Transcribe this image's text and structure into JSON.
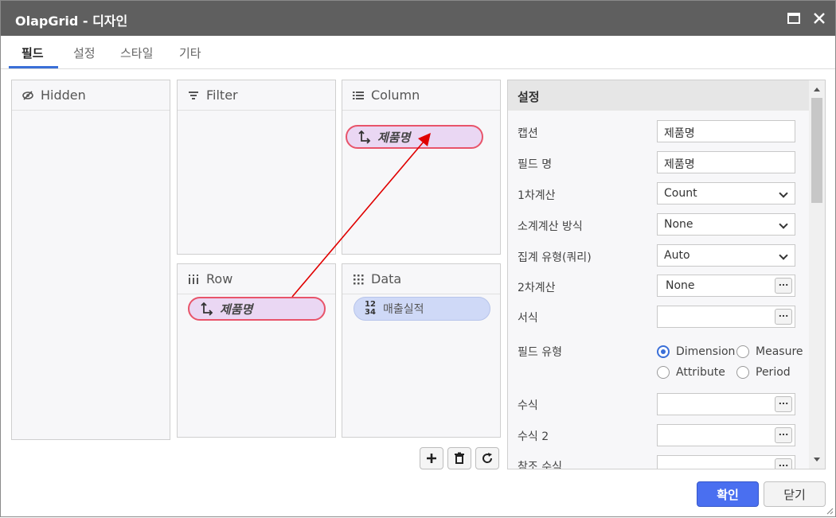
{
  "window": {
    "title": "OlapGrid - 디자인"
  },
  "tabs": [
    {
      "label": "필드",
      "active": true
    },
    {
      "label": "설정",
      "active": false
    },
    {
      "label": "스타일",
      "active": false
    },
    {
      "label": "기타",
      "active": false
    }
  ],
  "panels": {
    "hidden": {
      "title": "Hidden"
    },
    "filter": {
      "title": "Filter"
    },
    "column": {
      "title": "Column",
      "fields": [
        "제품명"
      ]
    },
    "row": {
      "title": "Row",
      "fields": [
        "제품명"
      ]
    },
    "data": {
      "title": "Data",
      "fields": [
        "매출실적"
      ],
      "icon_top": "12",
      "icon_bottom": "34"
    }
  },
  "settings": {
    "header": "설정",
    "caption": {
      "label": "캡션",
      "value": "제품명"
    },
    "field_name": {
      "label": "필드 명",
      "value": "제품명"
    },
    "calc1": {
      "label": "1차계산",
      "value": "Count"
    },
    "subtotal": {
      "label": "소계계산 방식",
      "value": "None"
    },
    "agg_type": {
      "label": "집계 유형(쿼리)",
      "value": "Auto"
    },
    "calc2": {
      "label": "2차계산",
      "value": "None"
    },
    "format": {
      "label": "서식",
      "value": ""
    },
    "field_type": {
      "label": "필드 유형",
      "options": [
        "Dimension",
        "Measure",
        "Attribute",
        "Period"
      ],
      "selected": "Dimension"
    },
    "formula": {
      "label": "수식",
      "value": ""
    },
    "formula2": {
      "label": "수식 2",
      "value": ""
    },
    "ref_formula": {
      "label": "참조 수식",
      "value": ""
    },
    "dots": "..."
  },
  "buttons": {
    "ok": "확인",
    "close": "닫기"
  },
  "colors": {
    "accent": "#3a6fd8",
    "dimension_chip": "#ead7f3",
    "measure_chip": "#cfd9f7",
    "drag_arrow": "#e00000"
  }
}
